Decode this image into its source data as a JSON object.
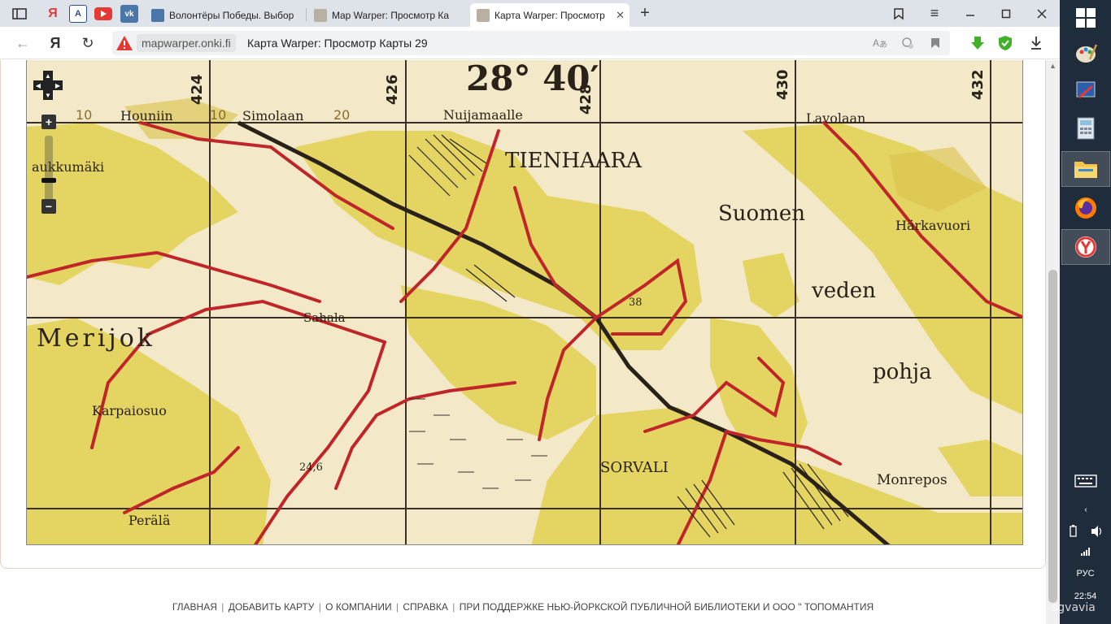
{
  "browser": {
    "tabs": [
      {
        "title": "Волонтёры Победы. Выбор",
        "active": false
      },
      {
        "title": "Map Warper: Просмотр Ка",
        "active": false
      },
      {
        "title": "Карта Warper: Просмотр",
        "active": true
      }
    ],
    "address": {
      "domain": "mapwarper.onki.fi",
      "page_title": "Карта Warper: Просмотр Карты 29"
    },
    "colors": {
      "tabbar": "#dee3ea",
      "accent_warning": "#e53935",
      "green_icon": "#43b02a"
    }
  },
  "map": {
    "labels": {
      "degree": "28° 40′",
      "tienhaara": "TIENHAARA",
      "suomen": "Suomen",
      "veden": "veden",
      "pohja": "pohja",
      "merijoki": "Merijok",
      "karpaiosuo": "Karpaiosuo",
      "sorvali": "SORVALI",
      "monrepos": "Monrepos",
      "harkavuori": "Härkavuori",
      "laukkumaki": "aukkumäki",
      "sahala": "Sahala",
      "perala": "Perälä",
      "houniin": "Houniin",
      "simolaan": "Simolaan",
      "nuijamaalle": "Nuijamaalle",
      "lavolaan": "Lavolaan",
      "num_10a": "10",
      "num_10b": "10",
      "num_20": "20",
      "num_38": "38",
      "num_246": "24,6",
      "num_424": "424",
      "num_426": "426",
      "num_428": "428",
      "num_430": "430",
      "num_432": "432"
    },
    "controls": {
      "zoom_in": "+",
      "zoom_out": "−"
    },
    "colors": {
      "paper": "#f3e9c8",
      "forest": "#e3d35a",
      "road": "#c0252a",
      "ink": "#2a2218"
    }
  },
  "footer": {
    "links": [
      "ГЛАВНАЯ",
      "ДОБАВИТЬ КАРТУ",
      "О КОМПАНИИ",
      "СПРАВКА",
      "ПРИ ПОДДЕРЖКЕ НЬЮ-ЙОРКСКОЙ ПУБЛИЧНОЙ БИБЛИОТЕКИ И ООО \" ТОПОМАНТИЯ"
    ],
    "separator": "|"
  },
  "taskbar": {
    "language": "РУС",
    "time": "22:54",
    "watermark": "sgvavia"
  }
}
